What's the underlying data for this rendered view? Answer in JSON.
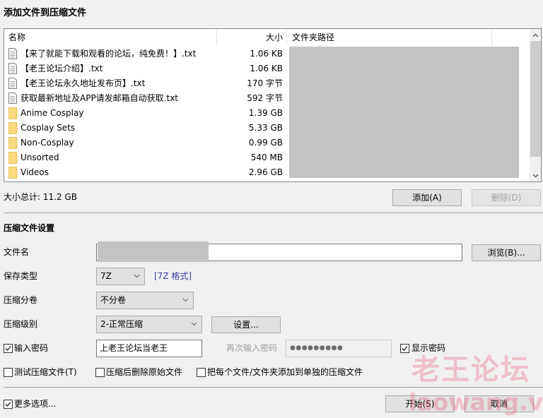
{
  "dialog": {
    "title": "添加文件到压缩文件"
  },
  "file_list": {
    "columns": {
      "name": "名称",
      "size": "大小",
      "path": "文件夹路径"
    },
    "rows": [
      {
        "type": "file",
        "name": "【来了就能下载和观看的论坛，纯免费！】.txt",
        "size": "1.06 KB"
      },
      {
        "type": "file",
        "name": "【老王论坛介绍】.txt",
        "size": "1.06 KB"
      },
      {
        "type": "file",
        "name": "【老王论坛永久地址发布页】.txt",
        "size": "170 字节"
      },
      {
        "type": "file",
        "name": "获取最新地址及APP请发邮箱自动获取.txt",
        "size": "592 字节"
      },
      {
        "type": "folder",
        "name": "Anime Cosplay",
        "size": "1.39 GB"
      },
      {
        "type": "folder",
        "name": "Cosplay Sets",
        "size": "5.33 GB"
      },
      {
        "type": "folder",
        "name": "Non-Cosplay",
        "size": "0.99 GB"
      },
      {
        "type": "folder",
        "name": "Unsorted",
        "size": "540 MB"
      },
      {
        "type": "folder",
        "name": "Videos",
        "size": "2.96 GB"
      }
    ]
  },
  "summary": {
    "total_label": "大小总计:",
    "total_value": "11.2 GB"
  },
  "list_buttons": {
    "add": "添加(A)",
    "delete": "删除(D)"
  },
  "settings": {
    "heading": "压缩文件设置",
    "filename": {
      "label": "文件名",
      "value": ""
    },
    "browse": "浏览(B)...",
    "format": {
      "label": "保存类型",
      "selected": "7Z",
      "info": "[7Z 格式]"
    },
    "volume": {
      "label": "压缩分卷",
      "selected": "不分卷"
    },
    "level": {
      "label": "压缩级别",
      "selected": "2-正常压缩"
    },
    "level_settings": "设置...",
    "password": {
      "checkbox_label": "输入密码",
      "checked": true,
      "value": "上老王论坛当老王",
      "confirm_label": "再次输入密码",
      "confirm_value": "●●●●●●●●●",
      "show_label": "显示密码",
      "show_checked": true
    },
    "options": [
      {
        "label": "测试压缩文件(T)",
        "checked": false
      },
      {
        "label": "压缩后删除原始文件",
        "checked": false
      },
      {
        "label": "把每个文件/文件夹添加到单独的压缩文件",
        "checked": false
      }
    ]
  },
  "footer": {
    "more_options": {
      "label": "更多选项...",
      "checked": true
    },
    "start": "开始(S)",
    "cancel": "取消"
  },
  "watermark": {
    "line1": "老王论坛",
    "line2": "laowang.vip"
  }
}
